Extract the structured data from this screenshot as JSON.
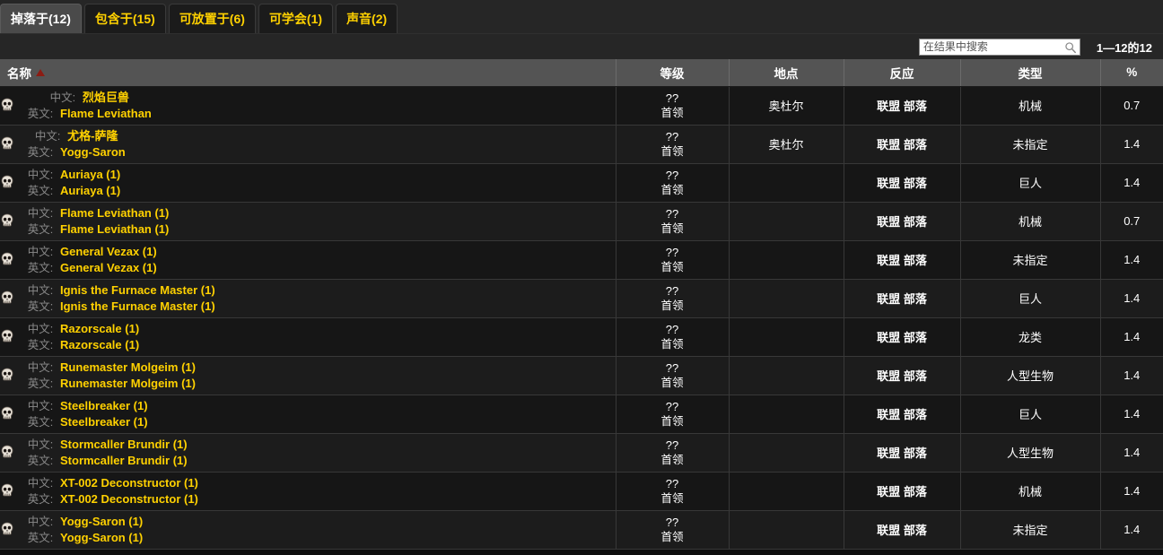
{
  "colors": {
    "tab_text": "#ffd100",
    "tab_active_text": "#ffffff",
    "link": "#ffd100",
    "hostile": "#c81f1f",
    "sort_arrow": "#8c1c13"
  },
  "tabs": [
    {
      "label": "掉落于(12)",
      "active": true,
      "name": "tab-drops-from"
    },
    {
      "label": "包含于(15)",
      "active": false,
      "name": "tab-contained-in"
    },
    {
      "label": "可放置于(6)",
      "active": false,
      "name": "tab-placeable-in"
    },
    {
      "label": "可学会(1)",
      "active": false,
      "name": "tab-teaches"
    },
    {
      "label": "声音(2)",
      "active": false,
      "name": "tab-sounds"
    }
  ],
  "toolbar": {
    "search_placeholder": "在结果中搜索",
    "search_value": "",
    "search_icon": "search-icon",
    "result_count": "1—12的12"
  },
  "table": {
    "headers": {
      "name": "名称",
      "level": "等级",
      "location": "地点",
      "reaction": "反应",
      "type": "类型",
      "percent": "%"
    },
    "sort": {
      "column": "名称",
      "direction": "asc"
    },
    "labels": {
      "chinese": "中文:",
      "english": "英文:"
    },
    "reaction": {
      "alliance": "联盟",
      "horde": "部落"
    },
    "rows": [
      {
        "zh": "烈焰巨兽",
        "en": "Flame Leviathan",
        "level": "??",
        "level_class": "首领",
        "location": "奥杜尔",
        "type": "机械",
        "percent": "0.7"
      },
      {
        "zh": "尤格-萨隆",
        "en": "Yogg-Saron",
        "level": "??",
        "level_class": "首领",
        "location": "奥杜尔",
        "type": "未指定",
        "percent": "1.4"
      },
      {
        "zh": "Auriaya (1)",
        "en": "Auriaya (1)",
        "level": "??",
        "level_class": "首领",
        "location": "",
        "type": "巨人",
        "percent": "1.4"
      },
      {
        "zh": "Flame Leviathan (1)",
        "en": "Flame Leviathan (1)",
        "level": "??",
        "level_class": "首领",
        "location": "",
        "type": "机械",
        "percent": "0.7"
      },
      {
        "zh": "General Vezax (1)",
        "en": "General Vezax (1)",
        "level": "??",
        "level_class": "首领",
        "location": "",
        "type": "未指定",
        "percent": "1.4"
      },
      {
        "zh": "Ignis the Furnace Master (1)",
        "en": "Ignis the Furnace Master (1)",
        "level": "??",
        "level_class": "首领",
        "location": "",
        "type": "巨人",
        "percent": "1.4"
      },
      {
        "zh": "Razorscale (1)",
        "en": "Razorscale (1)",
        "level": "??",
        "level_class": "首领",
        "location": "",
        "type": "龙类",
        "percent": "1.4"
      },
      {
        "zh": "Runemaster Molgeim (1)",
        "en": "Runemaster Molgeim (1)",
        "level": "??",
        "level_class": "首领",
        "location": "",
        "type": "人型生物",
        "percent": "1.4"
      },
      {
        "zh": "Steelbreaker (1)",
        "en": "Steelbreaker (1)",
        "level": "??",
        "level_class": "首领",
        "location": "",
        "type": "巨人",
        "percent": "1.4"
      },
      {
        "zh": "Stormcaller Brundir (1)",
        "en": "Stormcaller Brundir (1)",
        "level": "??",
        "level_class": "首领",
        "location": "",
        "type": "人型生物",
        "percent": "1.4"
      },
      {
        "zh": "XT-002 Deconstructor (1)",
        "en": "XT-002 Deconstructor (1)",
        "level": "??",
        "level_class": "首领",
        "location": "",
        "type": "机械",
        "percent": "1.4"
      },
      {
        "zh": "Yogg-Saron (1)",
        "en": "Yogg-Saron (1)",
        "level": "??",
        "level_class": "首领",
        "location": "",
        "type": "未指定",
        "percent": "1.4"
      }
    ]
  }
}
